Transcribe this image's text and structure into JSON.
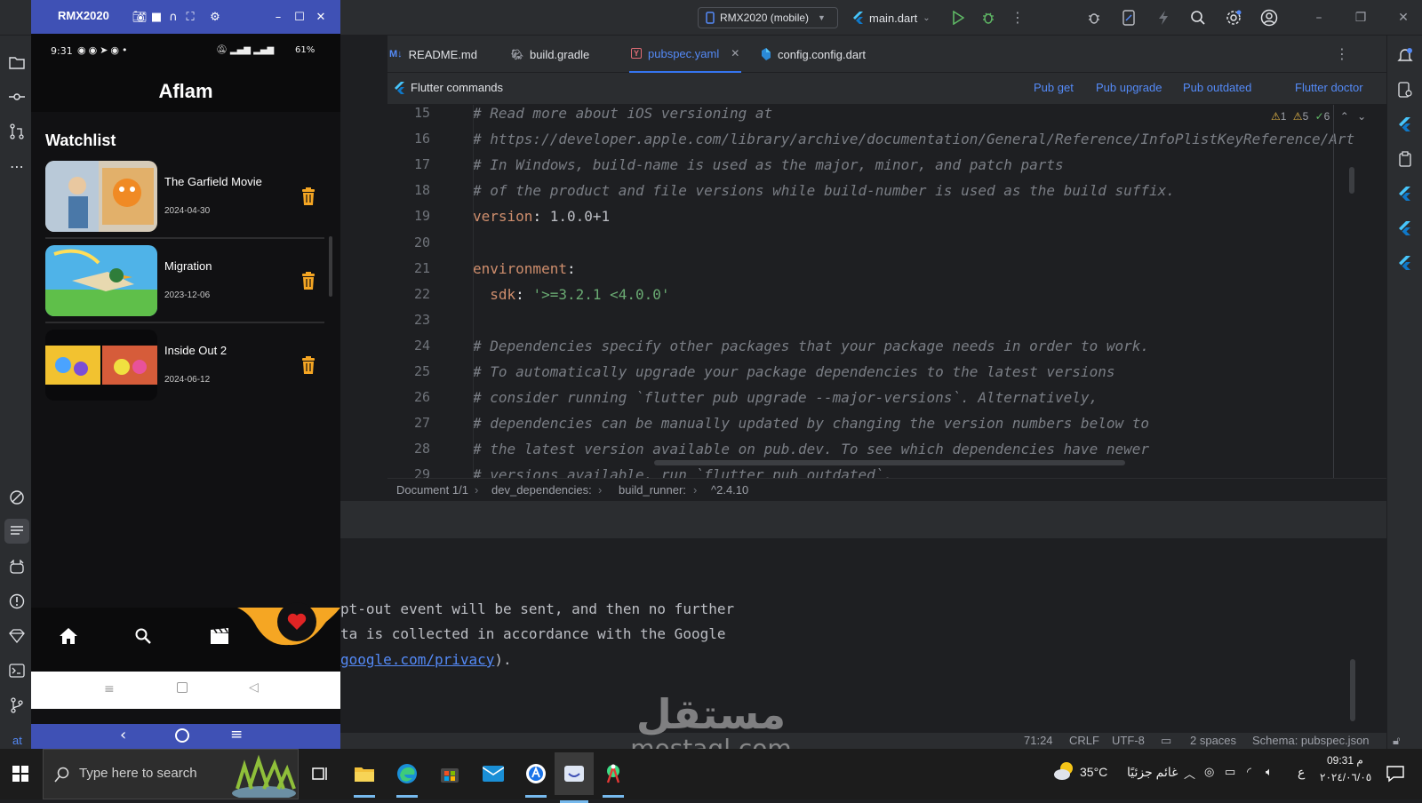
{
  "ide": {
    "device_selector": "RMX2020 (mobile)",
    "run_config": "main.dart",
    "tabs": [
      {
        "label": "README.md",
        "icon": "markdown-icon"
      },
      {
        "label": "build.gradle",
        "icon": "gradle-icon"
      },
      {
        "label": "pubspec.yaml",
        "icon": "yaml-icon",
        "active": true
      },
      {
        "label": "config.config.dart",
        "icon": "dart-icon"
      }
    ],
    "command_bar": {
      "title": "Flutter commands",
      "links": [
        "Pub get",
        "Pub upgrade",
        "Pub outdated",
        "Flutter doctor"
      ]
    },
    "inspections": {
      "errors": "1",
      "warnings": "5",
      "ok": "6"
    },
    "code_lines": [
      {
        "n": "15",
        "text": "# Read more about iOS versioning at"
      },
      {
        "n": "16",
        "text": "# https://developer.apple.com/library/archive/documentation/General/Reference/InfoPlistKeyReference/Art"
      },
      {
        "n": "17",
        "text": "# In Windows, build-name is used as the major, minor, and patch parts"
      },
      {
        "n": "18",
        "text": "# of the product and file versions while build-number is used as the build suffix."
      },
      {
        "n": "19",
        "key": "version",
        "value": "1.0.0+1"
      },
      {
        "n": "20",
        "text": ""
      },
      {
        "n": "21",
        "key": "environment",
        "value": ""
      },
      {
        "n": "22",
        "key": "sdk",
        "value": "'>=3.2.1 <4.0.0'"
      },
      {
        "n": "23",
        "text": ""
      },
      {
        "n": "24",
        "text": "# Dependencies specify other packages that your package needs in order to work."
      },
      {
        "n": "25",
        "text": "# To automatically upgrade your package dependencies to the latest versions"
      },
      {
        "n": "26",
        "text": "# consider running `flutter pub upgrade --major-versions`. Alternatively,"
      },
      {
        "n": "27",
        "text": "# dependencies can be manually updated by changing the version numbers below to"
      },
      {
        "n": "28",
        "text": "# the latest version available on pub.dev. To see which dependencies have newer"
      },
      {
        "n": "29",
        "text": "# versions available, run `flutter pub outdated`."
      }
    ],
    "breadcrumb": [
      "Document 1/1",
      "dev_dependencies:",
      "build_runner:",
      "^2.4.10"
    ],
    "tool_output": [
      "pt-out event will be sent, and then no further",
      "ta is collected in accordance with the Google"
    ],
    "tool_output_link": "google.com/privacy",
    "tool_output_link_suffix": ").",
    "status": {
      "left": "at",
      "position": "71:24",
      "line_sep": "CRLF",
      "encoding": "UTF-8",
      "indent": "2 spaces",
      "schema": "Schema: pubspec.json"
    }
  },
  "emulator": {
    "window_title": "RMX2020",
    "phone_status": {
      "time": "9:31",
      "battery": "61%"
    },
    "app_title": "Aflam",
    "section_title": "Watchlist",
    "movies": [
      {
        "title": "The Garfield Movie",
        "date": "2024-04-30"
      },
      {
        "title": "Migration",
        "date": "2023-12-06"
      },
      {
        "title": "Inside Out 2",
        "date": "2024-06-12"
      }
    ],
    "nav_items": [
      "home-icon",
      "search-icon",
      "clapperboard-icon",
      "heart-icon"
    ],
    "accent_color": "#f5a623"
  },
  "taskbar": {
    "search_placeholder": "Type here to search",
    "weather": "35°C",
    "weather_text": "غائم جزئيًا",
    "lang": "ع",
    "time": "09:31 م",
    "date": "٢٠٢٤/٠٦/٠٥"
  },
  "watermark": {
    "arabic": "مستقل",
    "latin": "mostaql.com"
  }
}
